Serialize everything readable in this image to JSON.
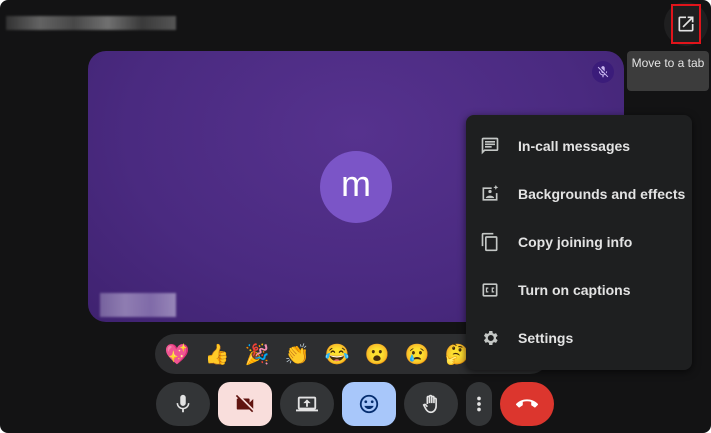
{
  "header": {
    "pip_tooltip": "Move to a tab"
  },
  "tile": {
    "avatar_letter": "m"
  },
  "menu": {
    "items": [
      {
        "label": "In-call messages",
        "icon": "chat-icon"
      },
      {
        "label": "Backgrounds and effects",
        "icon": "backgrounds-icon"
      },
      {
        "label": "Copy joining info",
        "icon": "copy-icon"
      },
      {
        "label": "Turn on captions",
        "icon": "captions-icon"
      },
      {
        "label": "Settings",
        "icon": "gear-icon"
      }
    ]
  },
  "reactions": [
    "💖",
    "👍",
    "🎉",
    "👏",
    "😂",
    "😮",
    "😢",
    "🤔"
  ],
  "colors": {
    "accent_red": "#dc362e",
    "camera_off_bg": "#f9dedc",
    "emoji_active_bg": "#a8c7fa",
    "tile": "#512f8a"
  }
}
